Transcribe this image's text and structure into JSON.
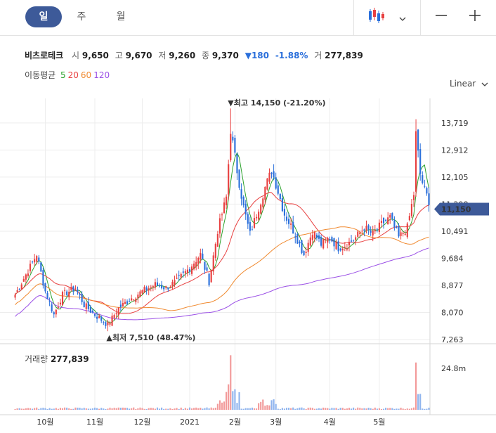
{
  "toolbar": {
    "tabs": [
      {
        "label": "일",
        "active": true
      },
      {
        "label": "주",
        "active": false
      },
      {
        "label": "월",
        "active": false
      }
    ],
    "chart_type_icon": "candlestick-icon",
    "dropdown_icon": "chevron-down-icon",
    "zoom_out_icon": "minus-icon",
    "zoom_in_icon": "plus-icon"
  },
  "stock": {
    "name": "비츠로테크",
    "open_label": "시",
    "open": "9,650",
    "high_label": "고",
    "high": "9,670",
    "low_label": "저",
    "low": "9,260",
    "close_label": "종",
    "close": "9,370",
    "change": "▼180",
    "change_pct": "-1.88%",
    "volume_label": "거",
    "volume": "277,839"
  },
  "ma_legend": {
    "label": "이동평균",
    "items": [
      {
        "period": "5",
        "color": "#2aa12a"
      },
      {
        "period": "20",
        "color": "#e84040"
      },
      {
        "period": "60",
        "color": "#f08a30"
      },
      {
        "period": "120",
        "color": "#9b50e6"
      }
    ]
  },
  "scale_button": "Linear",
  "current_price_tag": "11,150",
  "annotations": {
    "high_text": "▼최고 14,150 (-21.20%)",
    "low_text": "▲최저 7,510 (48.47%)"
  },
  "colors": {
    "up": "#e84040",
    "down": "#2a6fdb",
    "tag": "#3d5a99"
  },
  "volume_panel": {
    "label": "거래량",
    "value": "277,839"
  },
  "chart_data": {
    "type": "candlestick",
    "y_ticks": [
      "13,719",
      "12,912",
      "12,105",
      "11,298",
      "10,491",
      "9,684",
      "8,877",
      "8,070",
      "7,263"
    ],
    "y_tick_values": [
      13719,
      12912,
      12105,
      11298,
      10491,
      9684,
      8877,
      8070,
      7263
    ],
    "ylim": [
      7263,
      14450
    ],
    "x_labels": [
      "10월",
      "11월",
      "12월",
      "2021",
      "2월",
      "3월",
      "4월",
      "5월"
    ],
    "x_label_index": [
      14,
      37,
      59,
      81,
      102,
      121,
      146,
      169
    ],
    "volume_ticks": [
      "24.8m"
    ],
    "volume_ylim": [
      0,
      34000000
    ],
    "high_point": {
      "index": 100,
      "value": 14150
    },
    "low_point": {
      "index": 43,
      "value": 7510
    },
    "ma_periods": [
      5,
      20,
      60,
      120
    ],
    "key_closes": [
      [
        0,
        8600
      ],
      [
        10,
        9800
      ],
      [
        14,
        8700
      ],
      [
        18,
        8000
      ],
      [
        22,
        8600
      ],
      [
        28,
        8800
      ],
      [
        32,
        8300
      ],
      [
        37,
        8000
      ],
      [
        43,
        7700
      ],
      [
        48,
        8200
      ],
      [
        54,
        8500
      ],
      [
        59,
        8700
      ],
      [
        65,
        8900
      ],
      [
        70,
        8800
      ],
      [
        75,
        9000
      ],
      [
        81,
        9400
      ],
      [
        86,
        9800
      ],
      [
        90,
        9000
      ],
      [
        94,
        10500
      ],
      [
        98,
        11500
      ],
      [
        100,
        13500
      ],
      [
        103,
        12300
      ],
      [
        106,
        11200
      ],
      [
        109,
        10400
      ],
      [
        112,
        11000
      ],
      [
        116,
        11800
      ],
      [
        119,
        12300
      ],
      [
        121,
        11900
      ],
      [
        125,
        11000
      ],
      [
        130,
        10400
      ],
      [
        134,
        9800
      ],
      [
        138,
        10500
      ],
      [
        142,
        10100
      ],
      [
        146,
        10300
      ],
      [
        150,
        10000
      ],
      [
        154,
        10100
      ],
      [
        158,
        10300
      ],
      [
        162,
        10600
      ],
      [
        166,
        10400
      ],
      [
        170,
        10700
      ],
      [
        174,
        10900
      ],
      [
        178,
        10300
      ],
      [
        182,
        10600
      ],
      [
        185,
        11600
      ],
      [
        186,
        13400
      ],
      [
        188,
        12200
      ],
      [
        190,
        11700
      ],
      [
        192,
        11400
      ]
    ]
  }
}
